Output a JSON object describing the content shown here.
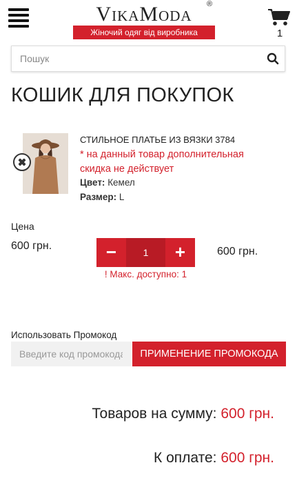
{
  "header": {
    "logo": "VikaModa",
    "logo_reg": "®",
    "tagline": "Жіночий одяг від виробника",
    "cart_count": "1"
  },
  "search": {
    "placeholder": "Пошук"
  },
  "page": {
    "title": "КОШИК ДЛЯ ПОКУПОК"
  },
  "item": {
    "name": "СТИЛЬНОЕ ПЛАТЬЕ ИЗ ВЯЗКИ 3784",
    "note": "* на данный товар дополнительная скидка не действует",
    "color_label": "Цвет:",
    "color_value": "Кемел",
    "size_label": "Размер:",
    "size_value": "L",
    "price_label": "Цена",
    "price": "600 грн.",
    "qty_minus": "−",
    "qty_value": "1",
    "qty_plus": "+",
    "line_total": "600 грн.",
    "max_note": "! Макс. доступно: 1"
  },
  "promo": {
    "label": "Использовать Промокод",
    "placeholder": "Введите код промокода",
    "button": "ПРИМЕНЕНИЕ ПРОМОКОДА"
  },
  "totals": {
    "subtotal_label": "Товаров на сумму:",
    "subtotal_value": "600 грн.",
    "pay_label": "К оплате:",
    "pay_value": "600 грн."
  },
  "colors": {
    "accent": "#d3212c",
    "accent_dark": "#b81b25"
  }
}
